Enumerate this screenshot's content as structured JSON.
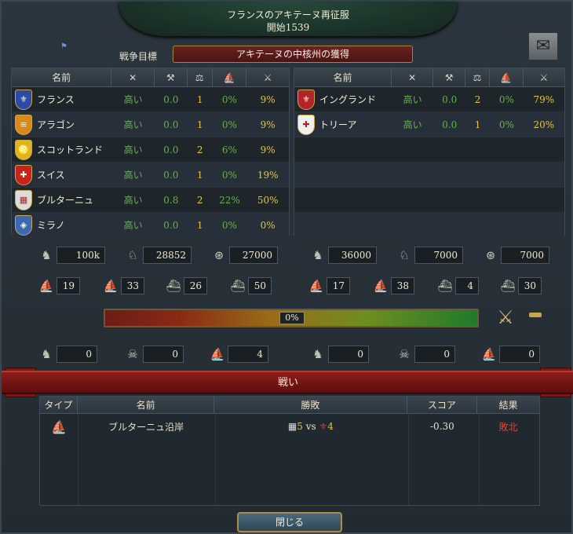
{
  "header": {
    "title": "フランスのアキテーヌ再征服",
    "subtitle": "開始1539"
  },
  "war_goal": {
    "label": "戦争目標",
    "value": "アキテーヌの中核州の獲得"
  },
  "columns": [
    "名前"
  ],
  "left": {
    "countries": [
      {
        "name": "フランス",
        "icon": "fleur-de-lis-shield-icon",
        "color": "#2c4aa8",
        "glyph": "⚜",
        "v1": "高い",
        "v2": "0.0",
        "v3": "1",
        "v4": "0%",
        "v5": "9%"
      },
      {
        "name": "アラゴン",
        "icon": "aragon-shield-icon",
        "color": "#d98a1c",
        "glyph": "≡",
        "v1": "高い",
        "v2": "0.0",
        "v3": "1",
        "v4": "0%",
        "v5": "9%"
      },
      {
        "name": "スコットランド",
        "icon": "scotland-shield-icon",
        "color": "#e0b323",
        "glyph": "♌",
        "v1": "高い",
        "v2": "0.0",
        "v3": "2",
        "v4": "6%",
        "v5": "9%"
      },
      {
        "name": "スイス",
        "icon": "swiss-shield-icon",
        "color": "#c8221c",
        "glyph": "✚",
        "v1": "高い",
        "v2": "0.0",
        "v3": "1",
        "v4": "0%",
        "v5": "19%"
      },
      {
        "name": "ブルターニュ",
        "icon": "brittany-shield-icon",
        "color": "#dcdcdc",
        "glyph": "▦",
        "v1": "高い",
        "v2": "0.8",
        "v3": "2",
        "v4": "22%",
        "v5": "50%"
      },
      {
        "name": "ミラノ",
        "icon": "milan-shield-icon",
        "color": "#3a6ab5",
        "glyph": "◈",
        "v1": "高い",
        "v2": "0.0",
        "v3": "1",
        "v4": "0%",
        "v5": "0%"
      }
    ],
    "army": {
      "infantry": "100k",
      "cavalry": "28852",
      "artillery": "27000"
    },
    "navy": {
      "heavy": "19",
      "light": "33",
      "galley": "26",
      "transport": "50"
    },
    "losses": {
      "infantry": "0",
      "cavalry": "0",
      "ships": "4"
    }
  },
  "right": {
    "countries": [
      {
        "name": "イングランド",
        "icon": "england-shield-icon",
        "color": "#b0242a",
        "glyph": "⚜",
        "v1": "高い",
        "v2": "0.0",
        "v3": "2",
        "v4": "0%",
        "v5": "79%"
      },
      {
        "name": "トリーア",
        "icon": "trier-shield-icon",
        "color": "#f0f0f0",
        "glyph": "✚",
        "v1": "高い",
        "v2": "0.0",
        "v3": "1",
        "v4": "0%",
        "v5": "20%"
      }
    ],
    "army": {
      "infantry": "36000",
      "cavalry": "7000",
      "artillery": "7000"
    },
    "navy": {
      "heavy": "17",
      "light": "38",
      "galley": "4",
      "transport": "30"
    },
    "losses": {
      "infantry": "0",
      "cavalry": "0",
      "ships": "0"
    }
  },
  "war_score": "0%",
  "battles": {
    "title": "戦い",
    "headers": [
      "タイプ",
      "名前",
      "勝敗",
      "スコア",
      "結果"
    ],
    "rows": [
      {
        "type_icon": "ship-icon",
        "name": "ブルターニュ沿岸",
        "left_count": "5",
        "vs": "vs",
        "right_count": "4",
        "score": "-0.30",
        "result": "敗北"
      }
    ]
  },
  "close_label": "閉じる",
  "colors": {
    "win_green": "#66b34c",
    "score_yellow": "#e0c54a",
    "defeat_red": "#d64a3a"
  }
}
